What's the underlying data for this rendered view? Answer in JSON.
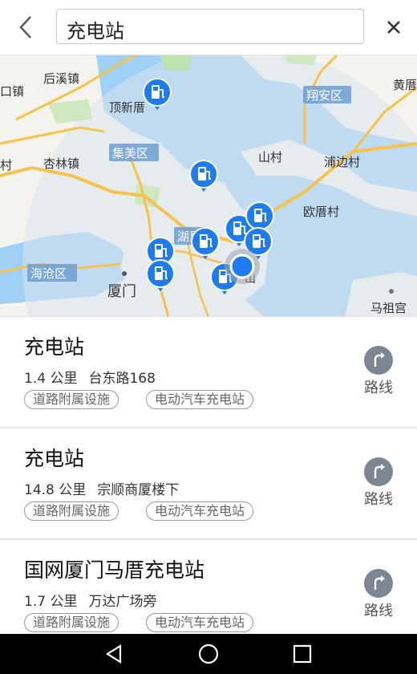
{
  "search": {
    "query": "充电站"
  },
  "icons": {
    "back": "back-arrow-icon",
    "close": "close-icon",
    "route": "route-turn-icon",
    "charger": "charging-station-pin-icon",
    "location": "current-location-dot-icon",
    "nav_back": "nav-back-icon",
    "nav_home": "nav-home-icon",
    "nav_recent": "nav-recents-icon"
  },
  "colors": {
    "water": "#9fd0f5",
    "land": "#f5f3ed",
    "accent": "#1f7cf0",
    "route_button": "#7a8792"
  },
  "map": {
    "labels": [
      "后溪镇",
      "口镇",
      "顶新厝",
      "杏林镇",
      "村",
      "山村",
      "浦边村",
      "欧厝村",
      "黄厝",
      "马祖宫",
      "厦门"
    ],
    "districts": [
      "翔安区",
      "集美区",
      "湖里",
      "海沧区"
    ],
    "partial_labels": [
      "山"
    ]
  },
  "results": [
    {
      "name": "充电站",
      "distance": "1.4 公里",
      "address": "台东路168",
      "tags": [
        "道路附属设施",
        "电动汽车充电站"
      ],
      "route_label": "路线"
    },
    {
      "name": "充电站",
      "distance": "14.8 公里",
      "address": "宗顺商厦楼下",
      "tags": [
        "道路附属设施",
        "电动汽车充电站"
      ],
      "route_label": "路线"
    },
    {
      "name": "国网厦门马厝充电站",
      "distance": "1.7 公里",
      "address": "万达广场旁",
      "tags": [
        "道路附属设施",
        "电动汽车充电站"
      ],
      "route_label": "路线"
    }
  ]
}
